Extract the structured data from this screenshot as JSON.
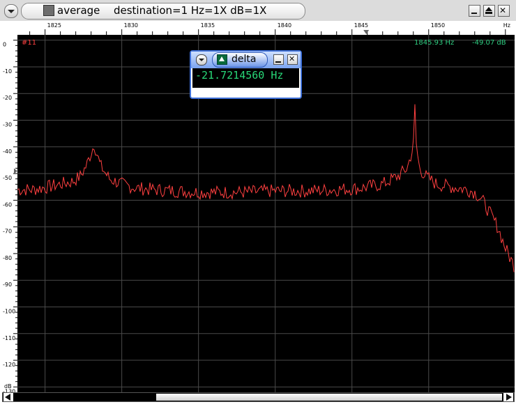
{
  "window": {
    "app_title": "average",
    "title_detail": "destination=1 Hz=1X dB=1X"
  },
  "axis": {
    "x_unit": "Hz",
    "y_unit": "dB",
    "x_ticks": [
      "1825",
      "1830",
      "1835",
      "1840",
      "1845",
      "1850"
    ],
    "y_ticks": [
      "0",
      "-10",
      "-20",
      "-30",
      "-40",
      "-50",
      "-60",
      "-70",
      "-80",
      "-90",
      "-100",
      "-110",
      "-120",
      "-130"
    ]
  },
  "plot": {
    "trace_label": "#11",
    "cursor_freq": "1845.93 Hz",
    "cursor_level": "-49.07 dB",
    "colors": {
      "trace": "#ff4040",
      "grid": "#4a4a4a",
      "background": "#000000",
      "readout": "#2fcf82"
    }
  },
  "delta_popup": {
    "title": "delta",
    "value": "-21.7214560 Hz"
  },
  "icons": {
    "menu": "chevron-down-icon",
    "minimize": "minimize-icon",
    "maximize": "maximize-icon",
    "close": "close-icon",
    "scroll_left": "arrow-left-icon",
    "scroll_right": "arrow-right-icon"
  },
  "chart_data": {
    "type": "line",
    "x_label": "Hz",
    "y_label": "dB",
    "xlim": [
      1823.2,
      1855.6
    ],
    "ylim": [
      -132,
      2
    ],
    "x_tick_values": [
      1825,
      1830,
      1835,
      1840,
      1845,
      1850
    ],
    "y_tick_values": [
      0,
      -10,
      -20,
      -30,
      -40,
      -50,
      -60,
      -70,
      -80,
      -90,
      -100,
      -110,
      -120,
      -130
    ],
    "grid": true,
    "series": [
      {
        "color": "#ff4040",
        "noise": 1.6,
        "x": [
          1823.2,
          1824.2,
          1825.2,
          1826.0,
          1826.8,
          1827.3,
          1827.7,
          1828.2,
          1828.6,
          1829.2,
          1830.0,
          1831.0,
          1832.0,
          1833.5,
          1835.0,
          1836.5,
          1838.0,
          1840.0,
          1842.0,
          1844.0,
          1845.5,
          1847.0,
          1848.0,
          1848.6,
          1849.0,
          1849.1,
          1849.2,
          1849.4,
          1849.8,
          1850.5,
          1851.5,
          1852.5,
          1853.0,
          1853.5,
          1854.0,
          1854.5,
          1855.0,
          1855.6
        ],
        "y": [
          -56,
          -56,
          -55,
          -54,
          -53,
          -51,
          -47,
          -39,
          -47,
          -52,
          -54,
          -55.5,
          -56,
          -56.5,
          -57,
          -57,
          -57,
          -56.5,
          -56.5,
          -56,
          -55.5,
          -54,
          -51,
          -48,
          -40,
          -25,
          -40,
          -48,
          -51,
          -54,
          -55,
          -56,
          -57,
          -60,
          -65,
          -70,
          -78,
          -85
        ]
      }
    ]
  }
}
